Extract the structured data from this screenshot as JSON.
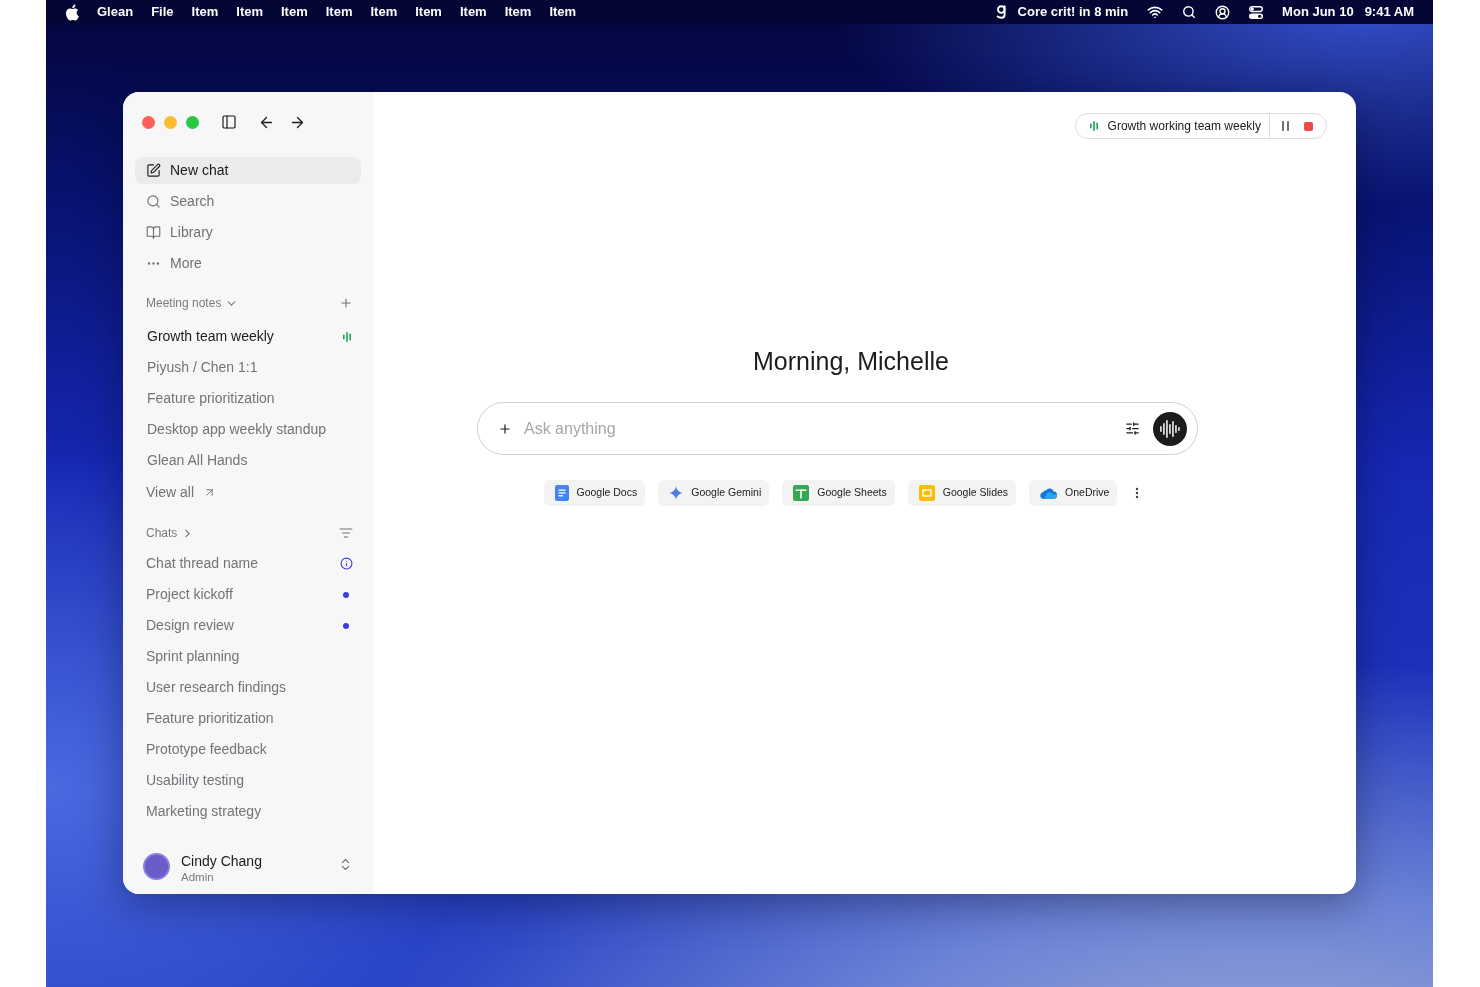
{
  "menu_bar": {
    "app_name": "Glean",
    "menus": [
      "File",
      "Item",
      "Item",
      "Item",
      "Item",
      "Item",
      "Item",
      "Item",
      "Item",
      "Item"
    ],
    "status_text": "Core crit! in 8 min",
    "date": "Mon Jun 10",
    "time": "9:41 AM"
  },
  "window": {
    "sidebar": {
      "nav": [
        {
          "label": "New chat",
          "kind": "new_chat",
          "selected": true
        },
        {
          "label": "Search",
          "kind": "search",
          "selected": false
        },
        {
          "label": "Library",
          "kind": "library",
          "selected": false
        },
        {
          "label": "More",
          "kind": "more",
          "selected": false
        }
      ],
      "meeting_notes": {
        "title": "Meeting notes",
        "items": [
          {
            "label": "Growth team weekly",
            "recording": true
          },
          {
            "label": "Piyush / Chen 1:1",
            "recording": false
          },
          {
            "label": "Feature prioritization",
            "recording": false
          },
          {
            "label": "Desktop app weekly standup",
            "recording": false
          },
          {
            "label": "Glean All Hands",
            "recording": false
          }
        ],
        "view_all": "View all"
      },
      "chats": {
        "title": "Chats",
        "items": [
          {
            "label": "Chat thread name",
            "kind": "info"
          },
          {
            "label": "Project kickoff",
            "kind": "unread"
          },
          {
            "label": "Design review",
            "kind": "unread"
          },
          {
            "label": "Sprint planning",
            "kind": "plain"
          },
          {
            "label": "User research findings",
            "kind": "plain"
          },
          {
            "label": "Feature prioritization",
            "kind": "plain"
          },
          {
            "label": "Prototype feedback",
            "kind": "plain"
          },
          {
            "label": "Usability testing",
            "kind": "plain"
          },
          {
            "label": "Marketing strategy",
            "kind": "plain"
          }
        ]
      },
      "user": {
        "name": "Cindy Chang",
        "role": "Admin"
      }
    },
    "recording_pill": {
      "title": "Growth working team weekly"
    },
    "greeting": "Morning, Michelle",
    "composer": {
      "placeholder": "Ask anything"
    },
    "sources": [
      {
        "label": "Google Docs",
        "kind": "docs"
      },
      {
        "label": "Google Gemini",
        "kind": "gemini"
      },
      {
        "label": "Google Sheets",
        "kind": "sheets"
      },
      {
        "label": "Google Slides",
        "kind": "slides"
      },
      {
        "label": "OneDrive",
        "kind": "onedrive"
      }
    ]
  }
}
